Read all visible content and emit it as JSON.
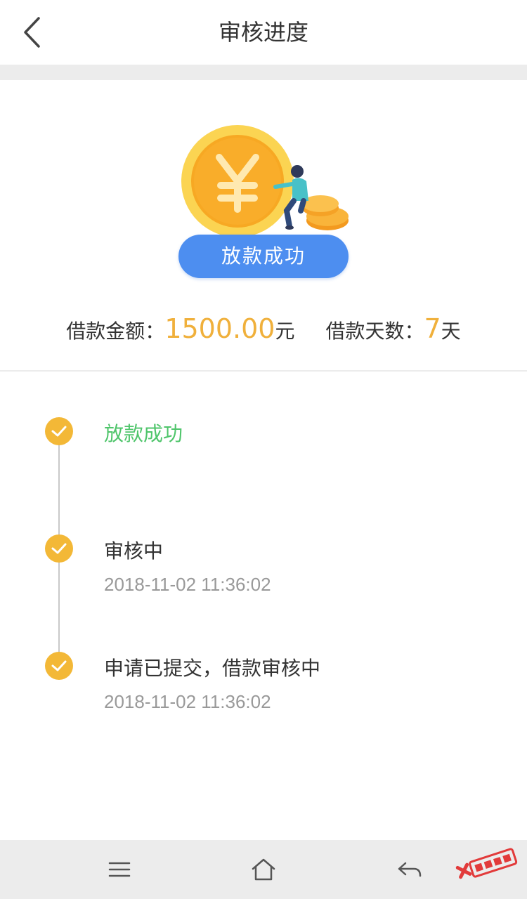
{
  "header": {
    "title": "审核进度",
    "back_icon": "chevron-left-icon"
  },
  "status": {
    "label": "放款成功",
    "color": "#4d8ef0"
  },
  "summary": {
    "amount_label": "借款金额：",
    "amount_value": "1500.00",
    "amount_unit": "元",
    "days_label": "借款天数：",
    "days_value": "7",
    "days_unit": "天",
    "accent_color": "#f0b03b"
  },
  "timeline": [
    {
      "title": "放款成功",
      "time": "",
      "state": "success"
    },
    {
      "title": "审核中",
      "time": "2018-11-02 11:36:02",
      "state": "done"
    },
    {
      "title": "申请已提交，借款审核中",
      "time": "2018-11-02 11:36:02",
      "state": "done"
    }
  ],
  "colors": {
    "success_text": "#4fc56b",
    "check_dot": "#f3b837",
    "line": "#c9c9c9"
  },
  "navbar": {
    "icons": [
      "menu-icon",
      "home-icon",
      "back-arrow-icon"
    ]
  },
  "watermark": {
    "text": "卡农社区"
  }
}
